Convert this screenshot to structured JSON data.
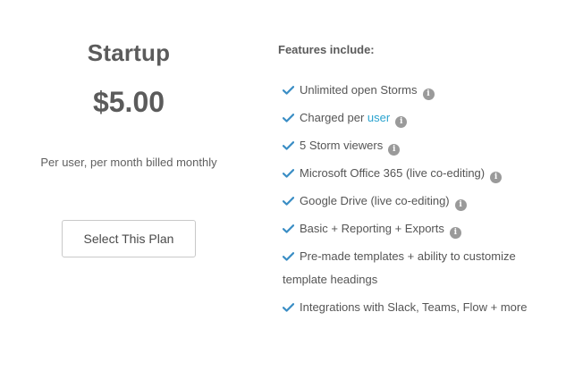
{
  "plan": {
    "name": "Startup",
    "price": "$5.00",
    "billing": "Per user, per month billed monthly",
    "select_label": "Select This Plan"
  },
  "features": {
    "heading": "Features include:",
    "items": [
      {
        "text": "Unlimited open Storms",
        "has_info": true
      },
      {
        "text_before": "Charged per ",
        "link": "user",
        "has_info": true
      },
      {
        "text": "5 Storm viewers",
        "has_info": true
      },
      {
        "text": "Microsoft Office 365 (live co-editing)",
        "has_info": true
      },
      {
        "text": "Google Drive (live co-editing)",
        "has_info": true
      },
      {
        "text": "Basic + Reporting + Exports",
        "has_info": true
      },
      {
        "text": "Pre-made templates + ability to customize template headings",
        "has_info": false
      },
      {
        "text": "Integrations with Slack, Teams, Flow + more",
        "has_info": false
      }
    ],
    "info_glyph": "i"
  },
  "colors": {
    "check": "#3b8ec5",
    "link": "#2aa3cf",
    "info_bg": "#9a9a9a"
  },
  "icons": {
    "check": "check-icon",
    "info": "info-icon"
  }
}
